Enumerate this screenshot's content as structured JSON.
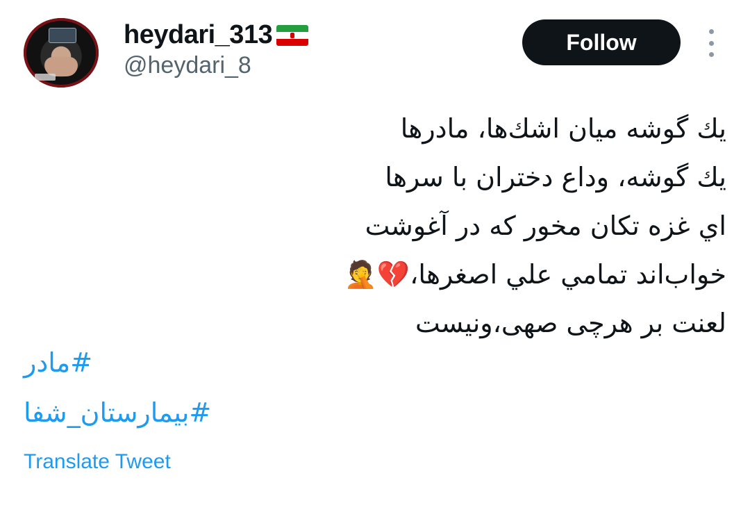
{
  "user": {
    "display_name": "heydari_313",
    "flag_icon": "iran-flag-icon",
    "handle": "@heydari_8",
    "avatar_icon": "profile-avatar"
  },
  "actions": {
    "follow_label": "Follow",
    "more_icon": "more-options-icon"
  },
  "tweet": {
    "lines": [
      "يك گوشه ميان اشك‌ها، مادرها",
      "يك گوشه، وداع دختران با سرها",
      "اي غزه تكان مخور كه در آغوشت",
      "خواب‌اند تمامي علي اصغرها،💔🤦",
      "لعنت بر هرچی صهی،ونیست"
    ],
    "hashtags": [
      "#مادر",
      "#بیمارستان_شفا"
    ],
    "translate_label": "Translate Tweet"
  },
  "colors": {
    "text": "#0f1419",
    "secondary": "#536471",
    "link": "#1d9bf0",
    "button_bg": "#0f1419",
    "button_text": "#ffffff"
  }
}
